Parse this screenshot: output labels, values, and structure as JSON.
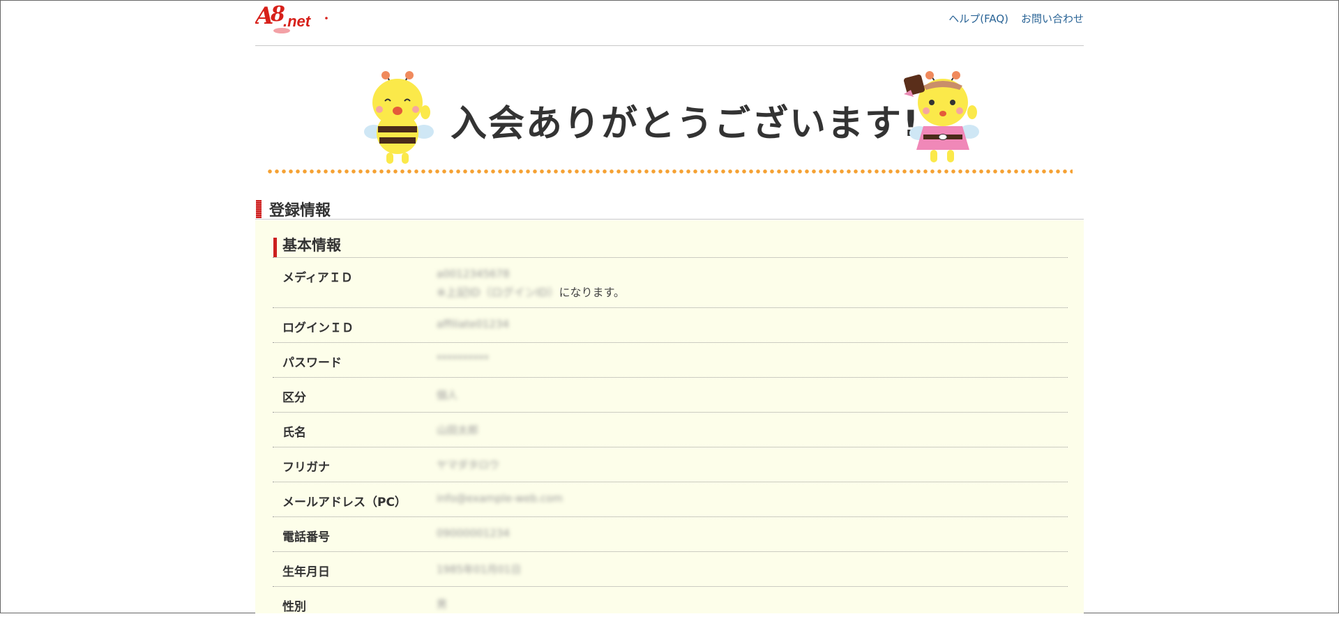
{
  "header": {
    "logo_text": "A8.net",
    "links": [
      "ヘルプ(FAQ)",
      "お問い合わせ"
    ]
  },
  "banner": {
    "title": "入会ありがとうございます!"
  },
  "section": {
    "title": "登録情報",
    "subsection_title": "基本情報"
  },
  "rows": [
    {
      "label": "メディアＩＤ",
      "value": "a0012345678",
      "note_blur": "※上記ID（ログインID）",
      "note": "になります。"
    },
    {
      "label": "ログインＩＤ",
      "value": "affiliate01234"
    },
    {
      "label": "パスワード",
      "value": "**********"
    },
    {
      "label": "区分",
      "value": "個人"
    },
    {
      "label": "氏名",
      "value": "山田太郎"
    },
    {
      "label": "フリガナ",
      "value": "ヤマダタロウ"
    },
    {
      "label": "メールアドレス（PC）",
      "value": "info@example-web.com"
    },
    {
      "label": "電話番号",
      "value": "09000001234"
    },
    {
      "label": "生年月日",
      "value": "1985年01月01日"
    },
    {
      "label": "性別",
      "value": "男"
    }
  ],
  "colors": {
    "accent_red": "#cc1f1f",
    "dots_orange": "#f5a133",
    "panel_bg": "#fdfeea",
    "link_blue": "#2a6496"
  }
}
